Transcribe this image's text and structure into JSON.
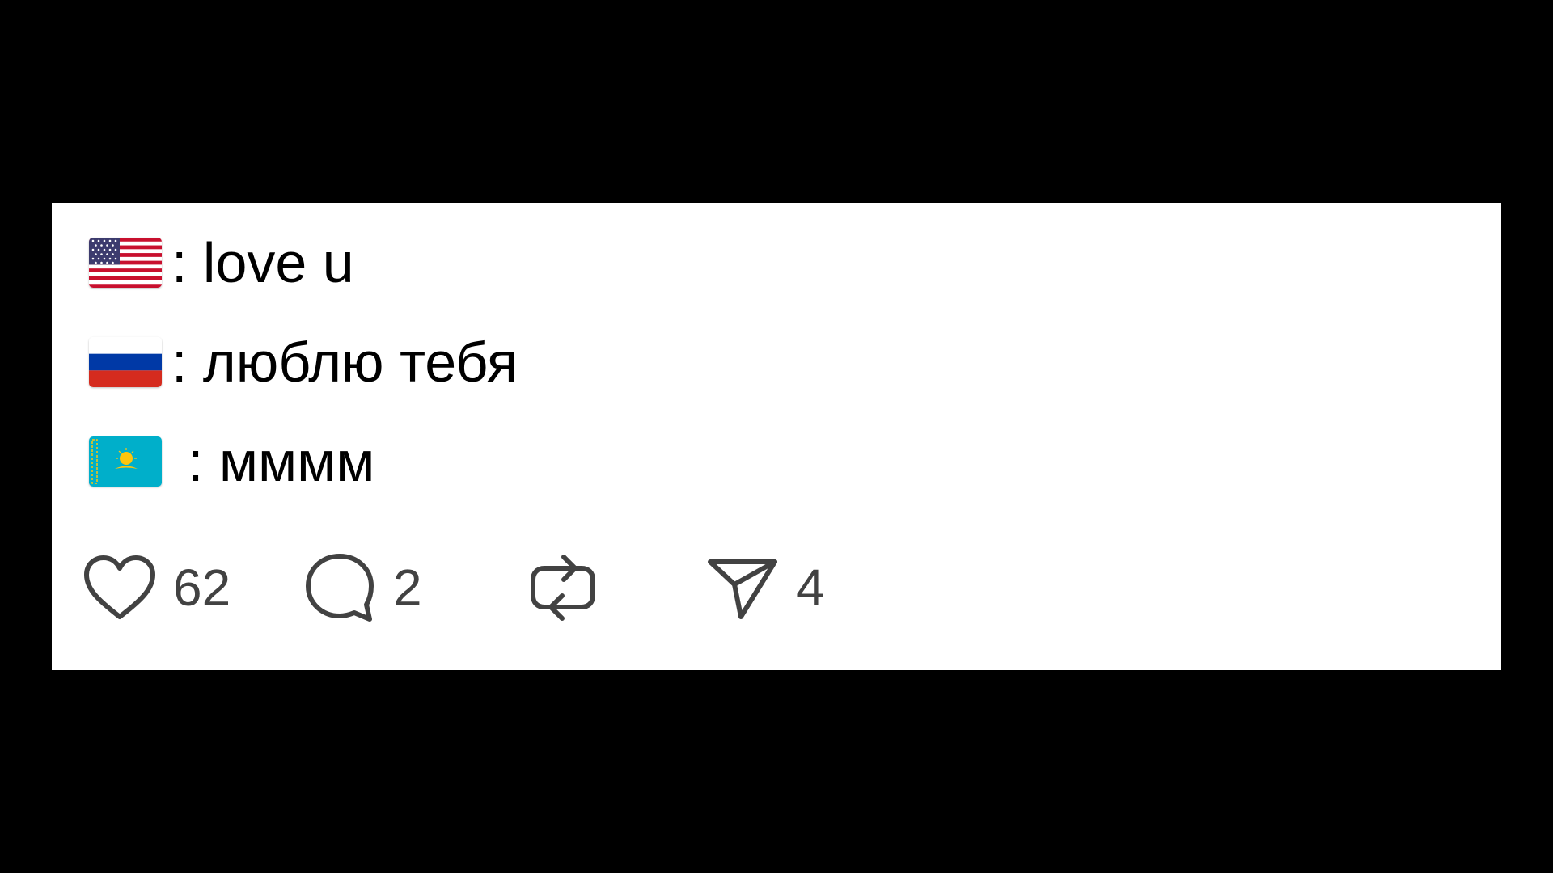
{
  "post": {
    "lines": [
      {
        "flag": "us-flag",
        "text": ": love u"
      },
      {
        "flag": "russia-flag",
        "text": ": люблю тебя"
      },
      {
        "flag": "kazakhstan-flag",
        "text": ": мммм"
      }
    ]
  },
  "actions": {
    "like": {
      "icon": "heart-icon",
      "count": "62"
    },
    "comment": {
      "icon": "comment-bubble-icon",
      "count": "2"
    },
    "repost": {
      "icon": "repost-icon"
    },
    "share": {
      "icon": "paper-plane-icon",
      "count": "4"
    }
  },
  "colors": {
    "background": "#000000",
    "card": "#ffffff",
    "text": "#000000",
    "icon": "#424242"
  }
}
